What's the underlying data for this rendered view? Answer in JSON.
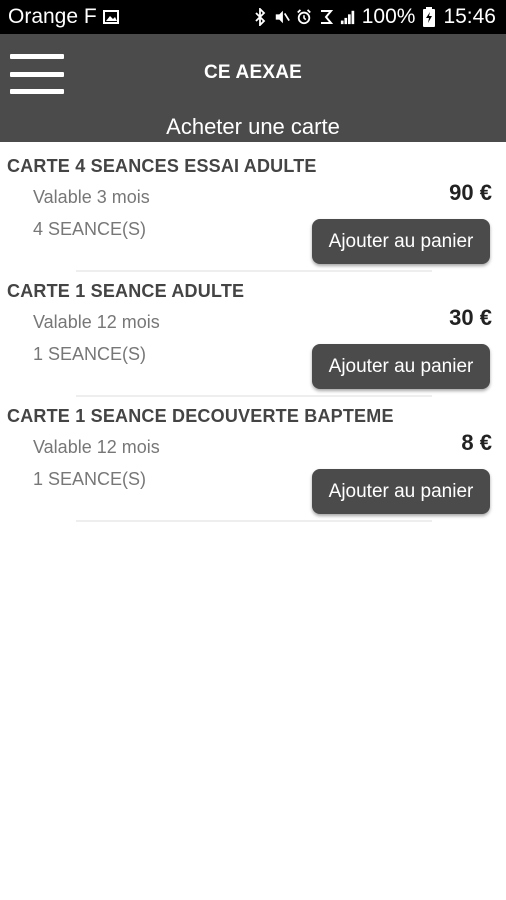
{
  "status_bar": {
    "carrier": "Orange F",
    "battery": "100%",
    "time": "15:46",
    "icons": [
      "image-icon",
      "bluetooth-icon",
      "mute-icon",
      "alarm-icon",
      "data-icon",
      "signal-icon",
      "battery-icon"
    ]
  },
  "header": {
    "title": "CE AEXAE",
    "subtitle": "Acheter une carte"
  },
  "cards": [
    {
      "title": "CARTE 4 SEANCES ESSAI ADULTE",
      "validity": "Valable 3 mois",
      "sessions": "4 SEANCE(S)",
      "price": "90 €",
      "button_label": "Ajouter au panier"
    },
    {
      "title": "CARTE 1 SEANCE ADULTE",
      "validity": "Valable 12 mois",
      "sessions": "1 SEANCE(S)",
      "price": "30 €",
      "button_label": "Ajouter au panier"
    },
    {
      "title": "CARTE 1 SEANCE DECOUVERTE BAPTEME",
      "validity": "Valable 12 mois",
      "sessions": "1 SEANCE(S)",
      "price": "8 €",
      "button_label": "Ajouter au panier"
    }
  ],
  "colors": {
    "header_bg": "#4b4b4b",
    "status_bg": "#000000",
    "button_bg": "#4b4b4b",
    "title_text": "#444444",
    "detail_text": "#777777"
  }
}
